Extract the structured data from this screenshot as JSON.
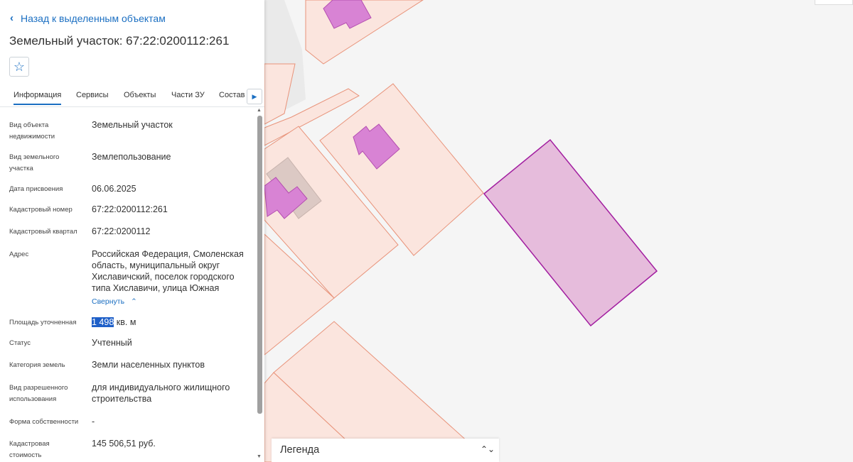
{
  "panel": {
    "back_label": "Назад к выделенным объектам",
    "title": "Земельный участок: 67:22:0200112:261",
    "favorite_icon": "star-outline-icon",
    "tabs": [
      "Информация",
      "Сервисы",
      "Объекты",
      "Части ЗУ",
      "Состав"
    ],
    "active_tab": "Информация",
    "collapse_label": "Свернуть",
    "area_label": "Площадь уточненная",
    "area_value": "1 498",
    "area_unit": "кв. м",
    "fields": [
      {
        "label": "Вид объекта недвижимости",
        "value": "Земельный участок"
      },
      {
        "label": "Вид земельного участка",
        "value": "Землепользование"
      },
      {
        "label": "Дата присвоения",
        "value": "06.06.2025"
      },
      {
        "label": "Кадастровый номер",
        "value": "67:22:0200112:261"
      },
      {
        "label": "Кадастровый квартал",
        "value": "67:22:0200112"
      },
      {
        "label": "Адрес",
        "value": "Российская Федерация, Смоленская область, муниципальный округ Хиславичский, поселок городского типа Хиславичи, улица Южная"
      },
      {
        "label": "Статус",
        "value": "Учтенный"
      },
      {
        "label": "Категория земель",
        "value": "Земли населенных пунктов"
      },
      {
        "label": "Вид разрешенного использования",
        "value": "для индивидуального жилищного строительства"
      },
      {
        "label": "Форма собственности",
        "value": "-"
      },
      {
        "label": "Кадастровая стоимость",
        "value": "145 506,51 руб."
      }
    ]
  },
  "legend": {
    "label": "Легенда"
  },
  "colors": {
    "accent": "#1b6fc2",
    "parcel_fill": "#fbe5de",
    "parcel_stroke": "#e8937a",
    "building_fill": "#d883d4",
    "building_stroke": "#b44fb0",
    "selected_fill": "#e6bcdc",
    "selected_stroke": "#a21ea0"
  }
}
